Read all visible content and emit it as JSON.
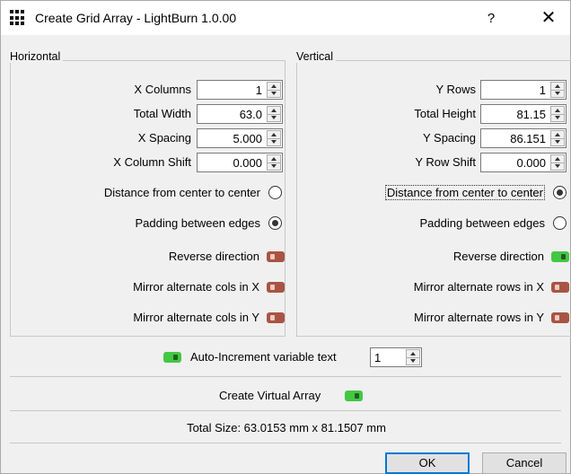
{
  "window": {
    "title": "Create Grid Array - LightBurn 1.0.00",
    "help": "?",
    "close": "✕"
  },
  "horizontal": {
    "group_title": "Horizontal",
    "fields": [
      {
        "label": "X Columns",
        "value": "1"
      },
      {
        "label": "Total Width",
        "value": "63.0"
      },
      {
        "label": "X Spacing",
        "value": "5.000"
      },
      {
        "label": "X Column Shift",
        "value": "0.000"
      }
    ],
    "radio_center": {
      "label": "Distance from center to center",
      "checked": false
    },
    "radio_padding": {
      "label": "Padding between edges",
      "checked": true
    },
    "reverse": {
      "label": "Reverse direction",
      "on": false
    },
    "mirror_x": {
      "label": "Mirror alternate cols in X",
      "on": false
    },
    "mirror_y": {
      "label": "Mirror alternate cols in Y",
      "on": false
    }
  },
  "vertical": {
    "group_title": "Vertical",
    "fields": [
      {
        "label": "Y Rows",
        "value": "1"
      },
      {
        "label": "Total Height",
        "value": "81.15"
      },
      {
        "label": "Y Spacing",
        "value": "86.151"
      },
      {
        "label": "Y Row Shift",
        "value": "0.000"
      }
    ],
    "radio_center": {
      "label": "Distance from center to center",
      "checked": true
    },
    "radio_padding": {
      "label": "Padding between edges",
      "checked": false
    },
    "reverse": {
      "label": "Reverse direction",
      "on": true
    },
    "mirror_x": {
      "label": "Mirror alternate rows in X",
      "on": false
    },
    "mirror_y": {
      "label": "Mirror alternate rows in Y",
      "on": false
    }
  },
  "auto_increment": {
    "label": "Auto-Increment variable text",
    "on": true,
    "value": "1"
  },
  "virtual_array": {
    "label": "Create Virtual Array",
    "on": true
  },
  "total_size": "Total Size: 63.0153 mm x 81.1507 mm",
  "buttons": {
    "ok": "OK",
    "cancel": "Cancel"
  },
  "colors": {
    "toggle_on": "#43c744",
    "toggle_off": "#a85444",
    "default_button_border": "#0078d7"
  }
}
